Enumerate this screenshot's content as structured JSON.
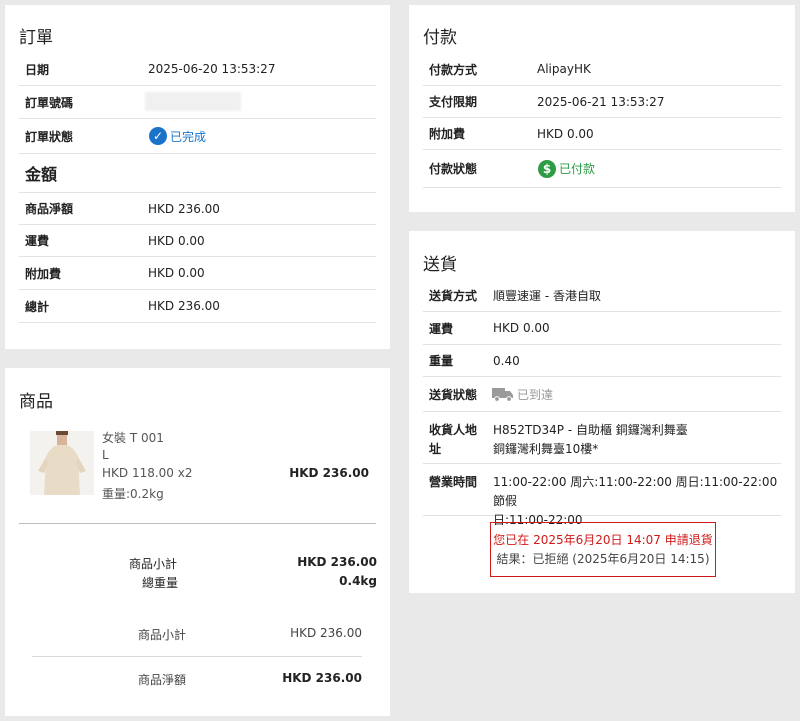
{
  "order": {
    "title": "訂單",
    "rows": [
      {
        "label": "日期",
        "value": "2025-06-20 13:53:27"
      },
      {
        "label": "訂單號碼",
        "value": ""
      },
      {
        "label": "訂單狀態",
        "value": "已完成"
      }
    ],
    "status_color": "#1a73c9",
    "amount_title": "金額",
    "amount_rows": [
      {
        "label": "商品淨額",
        "value": "HKD 236.00"
      },
      {
        "label": "運費",
        "value": "HKD 0.00"
      },
      {
        "label": "附加費",
        "value": "HKD 0.00"
      },
      {
        "label": "總計",
        "value": "HKD 236.00"
      }
    ]
  },
  "payment": {
    "title": "付款",
    "rows": [
      {
        "label": "付款方式",
        "value": "AlipayHK"
      },
      {
        "label": "支付限期",
        "value": "2025-06-21 13:53:27"
      },
      {
        "label": "附加費",
        "value": "HKD 0.00"
      },
      {
        "label": "付款狀態",
        "value": "已付款"
      }
    ],
    "status_color": "#2e9b45",
    "status_icon": "dollar-icon"
  },
  "products": {
    "title": "商品",
    "item": {
      "name": "女裝 T 001",
      "size": "L",
      "price_qty": "HKD 118.00 x2",
      "weight": "重量:0.2kg",
      "total": "HKD 236.00"
    },
    "summary": [
      {
        "label": "商品小計",
        "value": "HKD 236.00"
      },
      {
        "label": "總重量",
        "value": "0.4kg"
      }
    ],
    "footer": [
      {
        "label": "商品小計",
        "value": "HKD 236.00"
      },
      {
        "label": "商品淨額",
        "value": "HKD 236.00"
      }
    ]
  },
  "delivery": {
    "title": "送貨",
    "rows": [
      {
        "label": "送貨方式",
        "value": "順豐速運 - 香港自取"
      },
      {
        "label": "運費",
        "value": "HKD 0.00"
      },
      {
        "label": "重量",
        "value": "0.40"
      },
      {
        "label": "送貨狀態",
        "value": "已到達"
      }
    ],
    "status_icon": "truck-icon",
    "status_color": "#999999",
    "address_label_1": "收貨人地",
    "address_label_2": "址",
    "address_line_1": "H852TD34P - 自助櫃 銅鑼灣利舞臺",
    "address_line_2": "銅鑼灣利舞臺10樓*",
    "hours_label": "營業時間",
    "hours_line_1": "11:00-22:00 周六:11:00-22:00 周日:11:00-22:00 節假",
    "hours_line_2": "日:11:00-22:00",
    "refund": {
      "line1": "您已在 2025年6月20日 14:07 申請退貨",
      "line2": "結果：已拒絕 (2025年6月20日 14:15)",
      "color": "#d01a1a"
    }
  }
}
